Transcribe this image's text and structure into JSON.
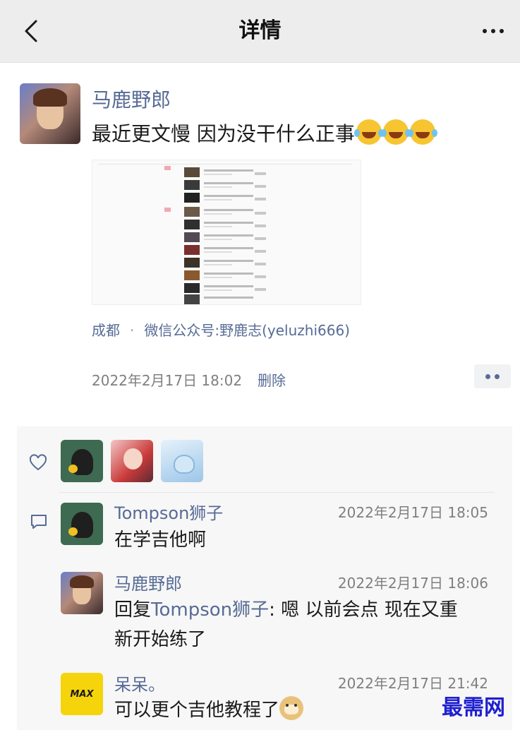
{
  "header": {
    "title": "详情",
    "back_icon": "chevron-left-icon",
    "more_icon": "more-dots-icon"
  },
  "post": {
    "author": "马鹿野郎",
    "text": "最近更文慢 因为没干什么正事",
    "emoji": "laugh-cry-emoji",
    "image": "screenshot-thumbnail",
    "location": "成都",
    "location_separator": "·",
    "link": "微信公众号:野鹿志(yeluzhi666)",
    "time": "2022年2月17日 18:02",
    "delete_label": "删除"
  },
  "likes": {
    "icon": "heart-icon",
    "count_avatars": 3
  },
  "comments_icon": "comment-icon",
  "comments": [
    {
      "name": "Tompson狮子",
      "time": "2022年2月17日 18:05",
      "text": "在学吉他啊"
    },
    {
      "name": "马鹿野郎",
      "time": "2022年2月17日 18:06",
      "reply_prefix": "回复",
      "reply_to": "Tompson狮子",
      "text_line1": ": 嗯 以前会点 现在又重",
      "text_line2": "新开始练了"
    },
    {
      "name": "呆呆。",
      "time": "2022年2月17日 21:42",
      "text": "可以更个吉他教程了",
      "emoji": "doge-emoji",
      "avatar_text": "MAX"
    }
  ],
  "watermark": "最需网",
  "colors": {
    "link": "#576b95",
    "header_bg": "#ededed",
    "panel_bg": "#f7f7f7"
  }
}
